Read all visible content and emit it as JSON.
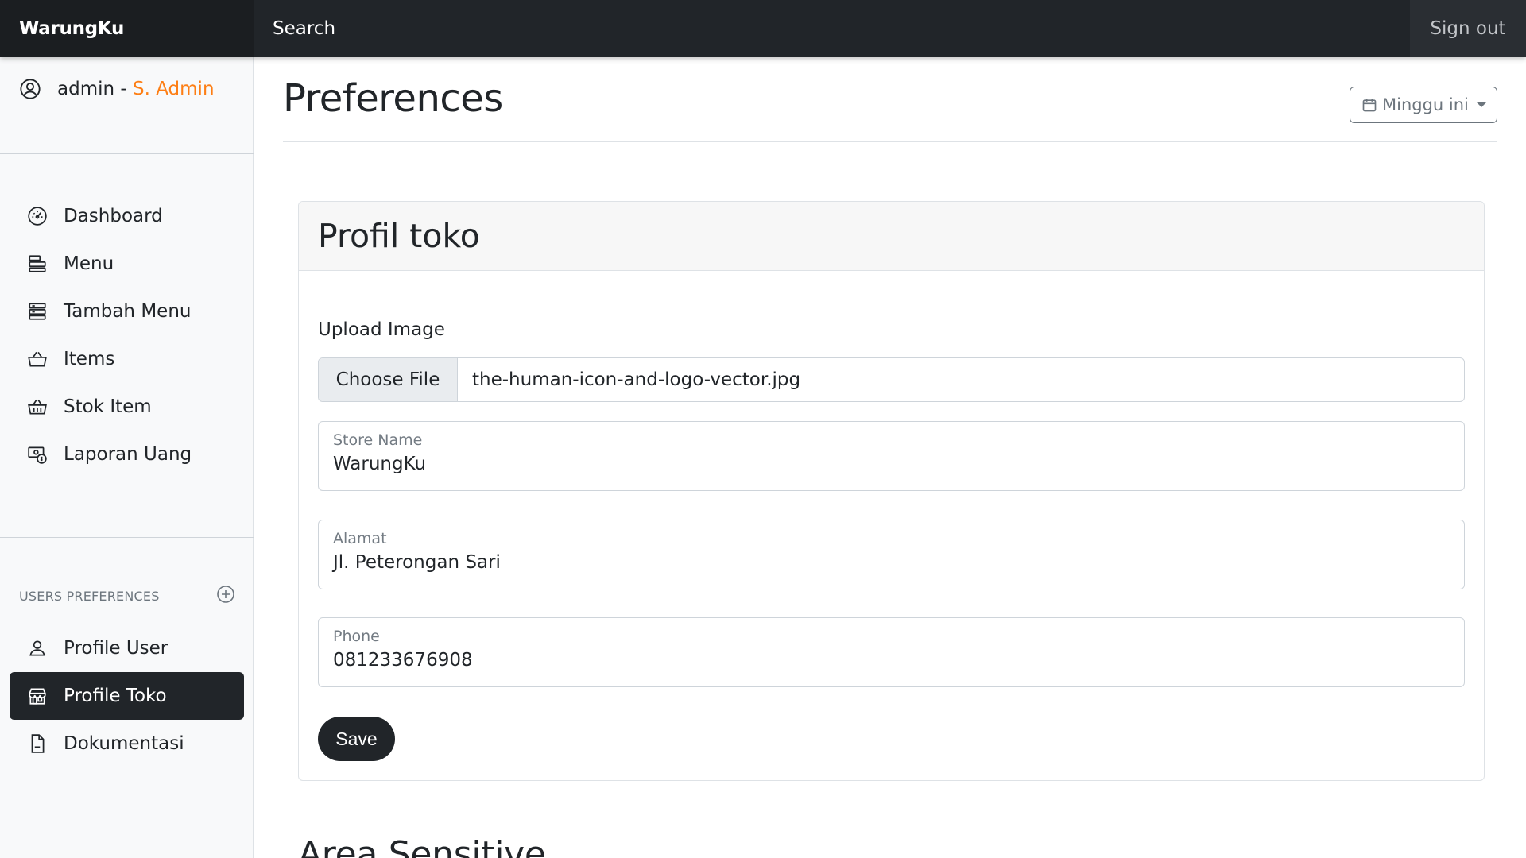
{
  "navbar": {
    "brand": "WarungKu",
    "search_label": "Search",
    "signout_label": "Sign out"
  },
  "sidebar": {
    "user": {
      "name": "admin - ",
      "role": "S. Admin",
      "role_color": "#fd7e14"
    },
    "main_items": [
      {
        "label": "Dashboard",
        "icon": "speedometer-icon"
      },
      {
        "label": "Menu",
        "icon": "menu-list-icon"
      },
      {
        "label": "Tambah Menu",
        "icon": "add-menu-icon"
      },
      {
        "label": "Items",
        "icon": "basket-icon"
      },
      {
        "label": "Stok Item",
        "icon": "basket-stock-icon"
      },
      {
        "label": "Laporan Uang",
        "icon": "cash-report-icon"
      }
    ],
    "section_heading": "USERS PREFERENCES",
    "pref_items": [
      {
        "label": "Profile User",
        "icon": "person-icon"
      },
      {
        "label": "Profile Toko",
        "icon": "shop-icon",
        "active": true
      },
      {
        "label": "Dokumentasi",
        "icon": "document-icon"
      }
    ]
  },
  "main": {
    "title": "Preferences",
    "range_button": "Minggu ini",
    "card": {
      "header": "Profil toko",
      "upload_label": "Upload Image",
      "file_button": "Choose File",
      "file_name": "the-human-icon-and-logo-vector.jpg",
      "fields": [
        {
          "label": "Store Name",
          "value": "WarungKu"
        },
        {
          "label": "Alamat",
          "value": "Jl. Peterongan Sari"
        },
        {
          "label": "Phone",
          "value": "081233676908"
        }
      ],
      "save_label": "Save"
    },
    "next_section_title": "Area Sensitive"
  },
  "colors": {
    "dark": "#212529",
    "accent": "#fd7e14",
    "sidebar_bg": "#f8f9fa"
  }
}
